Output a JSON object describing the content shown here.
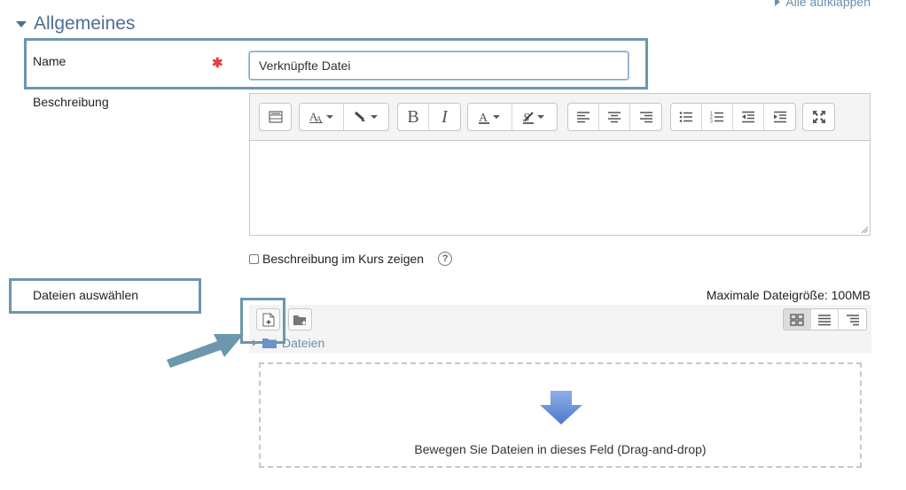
{
  "header": {
    "expand_all": "Alle aufklappen",
    "section_title": "Allgemeines"
  },
  "form": {
    "name_label": "Name",
    "name_value": "Verknüpfte Datei",
    "description_label": "Beschreibung",
    "show_description_label": "Beschreibung im Kurs zeigen",
    "files_label": "Dateien auswählen",
    "max_size": "Maximale Dateigröße: 100MB",
    "folder_name": "Dateien",
    "drop_text": "Bewegen Sie Dateien in dieses Feld (Drag-and-drop)",
    "required_symbol": "✱"
  },
  "colors": {
    "accent": "#4d6f92",
    "highlight_box": "#6c97ad",
    "required": "#e0403f",
    "link": "#6b8fb0",
    "drop_arrow": "#6a8fd8"
  },
  "toolbar": {
    "bold": "B",
    "italic": "I",
    "icons": [
      "table-icon",
      "font-size-icon",
      "highlight-pen-icon",
      "bold-icon",
      "italic-icon",
      "font-color-icon",
      "background-color-icon",
      "align-left-icon",
      "align-center-icon",
      "align-right-icon",
      "bullet-list-icon",
      "numbered-list-icon",
      "outdent-icon",
      "indent-icon",
      "fullscreen-icon"
    ]
  }
}
